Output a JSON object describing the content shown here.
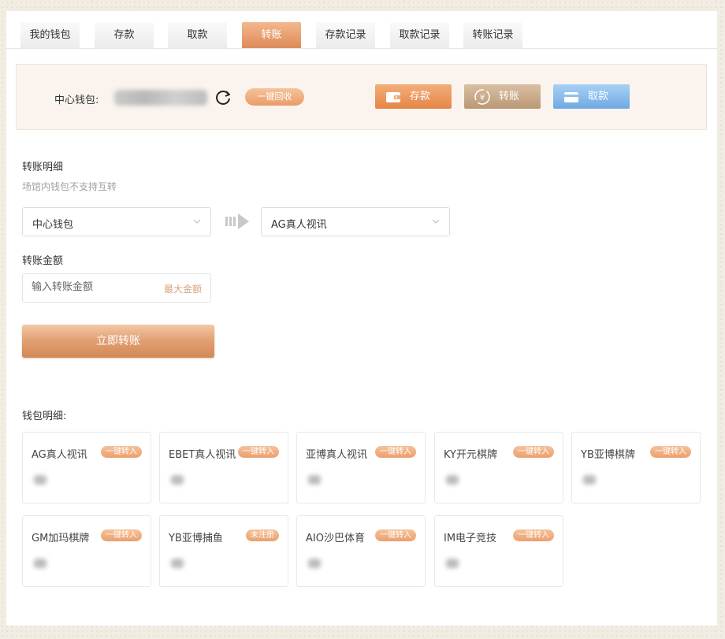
{
  "tabs": [
    {
      "label": "我的钱包",
      "active": false
    },
    {
      "label": "存款",
      "active": false
    },
    {
      "label": "取款",
      "active": false
    },
    {
      "label": "转账",
      "active": true
    },
    {
      "label": "存款记录",
      "active": false
    },
    {
      "label": "取款记录",
      "active": false
    },
    {
      "label": "转账记录",
      "active": false
    }
  ],
  "wallet": {
    "label": "中心钱包:",
    "recycle_label": "一键回收",
    "deposit_label": "存款",
    "transfer_label": "转账",
    "withdraw_label": "取款"
  },
  "transfer": {
    "title": "转账明细",
    "hint": "场馆内钱包不支持互转",
    "from_value": "中心钱包",
    "to_value": "AG真人视讯",
    "amount_title": "转账金额",
    "amount_placeholder": "输入转账金额",
    "max_label": "最大金额",
    "submit_label": "立即转账"
  },
  "wallets": {
    "title": "钱包明细:",
    "items": [
      {
        "name": "AG真人视讯",
        "tag": "一键转入"
      },
      {
        "name": "EBET真人视讯",
        "tag": "一键转入"
      },
      {
        "name": "亚博真人视讯",
        "tag": "一键转入"
      },
      {
        "name": "KY开元棋牌",
        "tag": "一键转入"
      },
      {
        "name": "YB亚博棋牌",
        "tag": "一键转入"
      },
      {
        "name": "GM加玛棋牌",
        "tag": "一键转入"
      },
      {
        "name": "YB亚博捕鱼",
        "tag": "未注册"
      },
      {
        "name": "AIO沙巴体育",
        "tag": "一键转入"
      },
      {
        "name": "IM电子竞技",
        "tag": "一键转入"
      }
    ]
  },
  "colors": {
    "accent": "#e68547",
    "transfer_button": "#b99775",
    "withdraw_button": "#6fa9e3"
  }
}
